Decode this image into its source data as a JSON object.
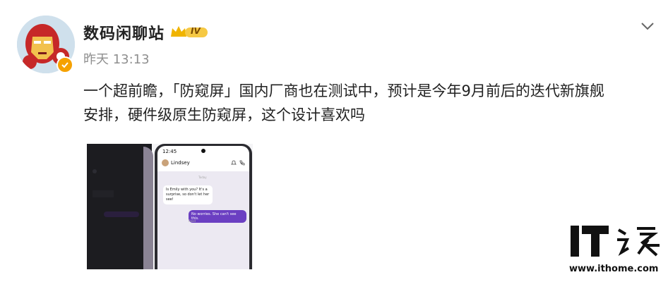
{
  "post": {
    "author": "数码闲聊站",
    "level_badge": "IV",
    "timestamp": "昨天 13:13",
    "text_line1": "一个超前瞻，「防窥屏」国内厂商也在测试中，预计是今年9月前后的迭代新旗舰",
    "text_line2": "安排，硬件级原生防窥屏，这个设计喜欢吗"
  },
  "media": {
    "status_time": "12:45",
    "contact_name": "Lindsey",
    "day_label": "Today",
    "incoming_message": "Is Emily with you? It's a surprise, so don't let her see!",
    "outgoing_message": "No worries. She can't see this.",
    "read_label": "Read"
  },
  "watermark": {
    "url": "www.ithome.com"
  },
  "colors": {
    "text": "#222222",
    "muted": "#8f8f8f",
    "verified": "#f5a100",
    "bubble_out": "#6b3fc2"
  }
}
